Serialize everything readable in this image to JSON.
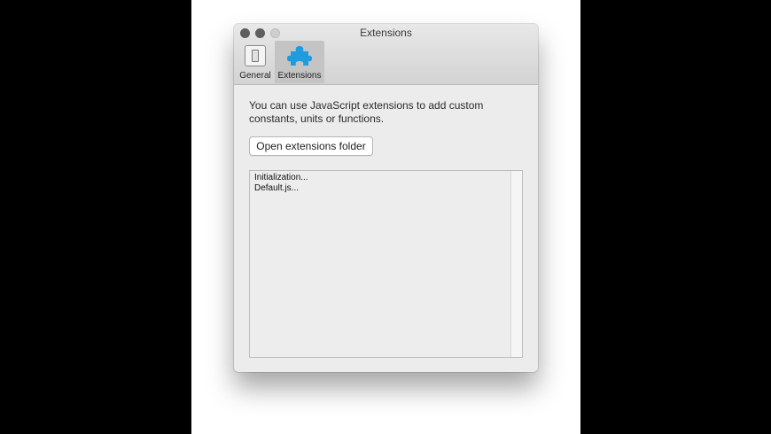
{
  "window": {
    "title": "Extensions"
  },
  "toolbar": {
    "tabs": [
      {
        "label": "General",
        "icon": "general-switch-icon"
      },
      {
        "label": "Extensions",
        "icon": "puzzle-piece-icon",
        "selected": true
      }
    ]
  },
  "main": {
    "description": "You can use JavaScript extensions to add custom constants, units or functions.",
    "open_folder_label": "Open extensions folder",
    "log_lines": [
      "Initialization...",
      "Default.js..."
    ]
  },
  "colors": {
    "accent": "#1f9be0"
  }
}
